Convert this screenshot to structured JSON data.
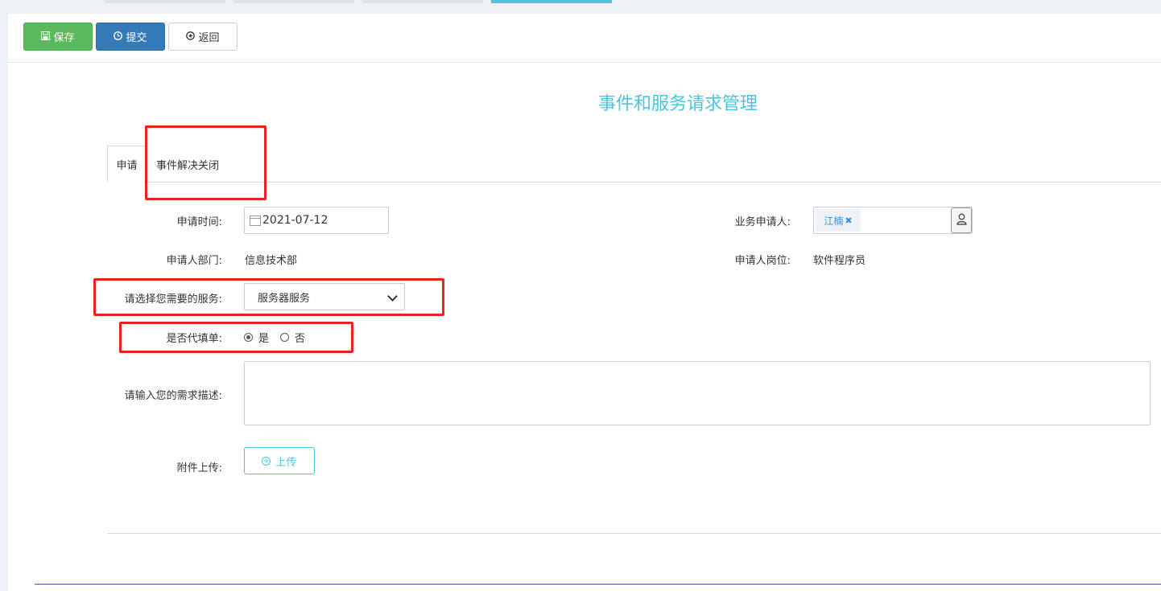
{
  "toolbar": {
    "save_label": "保存",
    "submit_label": "提交",
    "back_label": "返回"
  },
  "page_title": "事件和服务请求管理",
  "tabs": [
    {
      "label": "申请"
    },
    {
      "label": "事件解决关闭"
    }
  ],
  "form": {
    "apply_time_label": "申请时间:",
    "apply_time_value": "2021-07-12",
    "applicant_label": "业务申请人:",
    "applicant_tag": "江楠",
    "dept_label": "申请人部门:",
    "dept_value": "信息技术部",
    "position_label": "申请人岗位:",
    "position_value": "软件程序员",
    "service_label": "请选择您需要的服务:",
    "service_value": "服务器服务",
    "proxy_label": "是否代填单:",
    "proxy_yes": "是",
    "proxy_no": "否",
    "proxy_selected": "是",
    "desc_label": "请输入您的需求描述:",
    "attach_label": "附件上传:",
    "upload_label": "上传"
  },
  "icons": {
    "save": "floppy-icon",
    "submit": "clock-icon",
    "back": "back-circle-icon",
    "date": "calendar-icon",
    "person": "user-icon",
    "upload": "plus-circle-icon"
  },
  "colors": {
    "accent": "#4cc3d9",
    "save": "#5cb85c",
    "submit": "#337ab7",
    "highlight": "#e8231f"
  }
}
